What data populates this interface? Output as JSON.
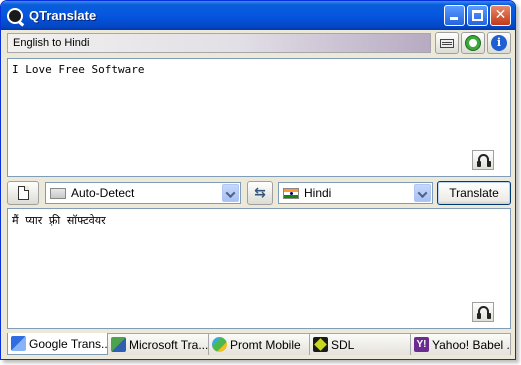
{
  "window": {
    "title": "QTranslate"
  },
  "toolbar": {
    "direction_label": "English to Hindi"
  },
  "source": {
    "text": "I Love Free Software"
  },
  "controls": {
    "source_language": "Auto-Detect",
    "target_language": "Hindi",
    "translate_label": "Translate"
  },
  "result": {
    "text": "मैं प्यार फ़्री सॉफ्टवेयर"
  },
  "services": [
    {
      "label": "Google Trans..."
    },
    {
      "label": "Microsoft Tra..."
    },
    {
      "label": "Promt Mobile"
    },
    {
      "label": "SDL"
    },
    {
      "label": "Yahoo! Babel ..."
    }
  ],
  "icons": {
    "yahoo_glyph": "Y!"
  },
  "colors": {
    "titlebar": "#0556e0",
    "frame": "#ece9d8",
    "field_border": "#7f9db9"
  }
}
